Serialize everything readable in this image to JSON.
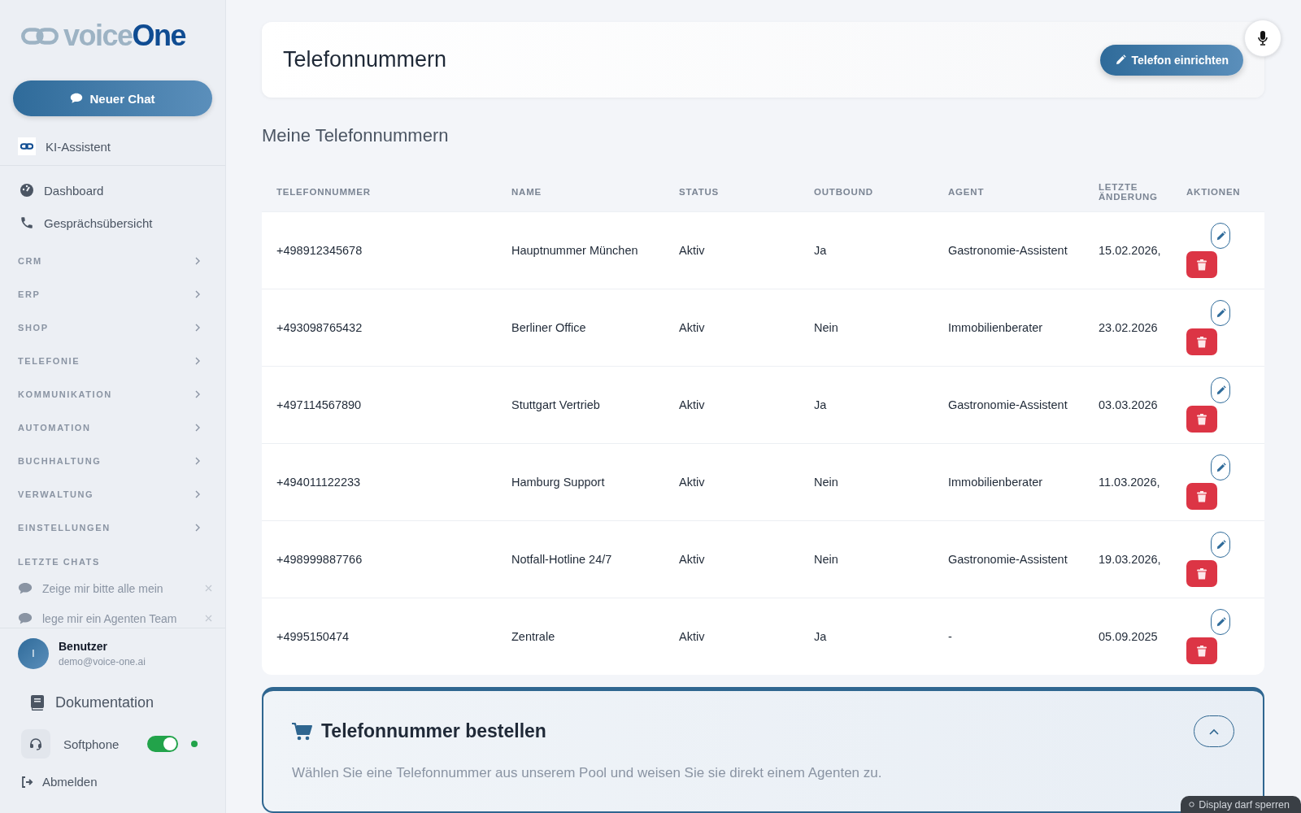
{
  "sidebar": {
    "logo": {
      "light": "voice",
      "bold": "One"
    },
    "new_chat_button": "Neuer Chat",
    "assistant": "KI-Assistent",
    "nav": [
      {
        "kind": "link",
        "label": "Dashboard"
      },
      {
        "kind": "link",
        "label": "Gesprächsübersicht"
      },
      {
        "kind": "group",
        "label": "CRM",
        "expanded": false
      },
      {
        "kind": "group",
        "label": "ERP",
        "expanded": false
      },
      {
        "kind": "group",
        "label": "SHOP",
        "expanded": false
      },
      {
        "kind": "group",
        "label": "TELEFONIE",
        "expanded": false
      },
      {
        "kind": "group",
        "label": "KOMMUNIKATION",
        "expanded": false
      },
      {
        "kind": "group",
        "label": "AUTOMATION",
        "expanded": false
      },
      {
        "kind": "group",
        "label": "BUCHHALTUNG",
        "expanded": false
      },
      {
        "kind": "group",
        "label": "VERWALTUNG",
        "expanded": false
      },
      {
        "kind": "group",
        "label": "EINSTELLUNGEN",
        "expanded": false
      }
    ],
    "recent_title": "LETZTE CHATS",
    "recent_chats": [
      "Zeige mir bitte alle mein",
      "lege mir ein Agenten Team"
    ],
    "user": {
      "initial": "I",
      "name": "Benutzer",
      "email": "demo@voice-one.ai"
    },
    "documentation": "Dokumentation",
    "softphone": {
      "label": "Softphone",
      "on": true,
      "color": "#22a34a"
    },
    "logout": "Abmelden"
  },
  "header": {
    "title": "Telefonnummern",
    "button": "Telefon einrichten"
  },
  "section_title": "Meine Telefonnummern",
  "table": {
    "columns": [
      "TELEFONNUMMER",
      "NAME",
      "STATUS",
      "OUTBOUND",
      "AGENT",
      "LETZTE ÄNDERUNG",
      "AKTIONEN"
    ],
    "rows": [
      [
        "+498912345678",
        "Hauptnummer München",
        "Aktiv",
        "Ja",
        "Gastronomie-Assistent",
        "15.02.2026,"
      ],
      [
        "+493098765432",
        "Berliner Office",
        "Aktiv",
        "Nein",
        "Immobilienberater",
        "23.02.2026"
      ],
      [
        "+497114567890",
        "Stuttgart Vertrieb",
        "Aktiv",
        "Ja",
        "Gastronomie-Assistent",
        "03.03.2026"
      ],
      [
        "+494011122233",
        "Hamburg Support",
        "Aktiv",
        "Nein",
        "Immobilienberater",
        "11.03.2026,"
      ],
      [
        "+498999887766",
        "Notfall-Hotline 24/7",
        "Aktiv",
        "Nein",
        "Gastronomie-Assistent",
        "19.03.2026,"
      ],
      [
        "+4995150474",
        "Zentrale",
        "Aktiv",
        "Ja",
        "-",
        "05.09.2025"
      ]
    ]
  },
  "order": {
    "title": "Telefonnummer bestellen",
    "expanded": true,
    "description": "Wählen Sie eine Telefonnummer aus unserem Pool und weisen Sie sie direkt einem Agenten zu."
  },
  "toast": "Display darf sperren"
}
